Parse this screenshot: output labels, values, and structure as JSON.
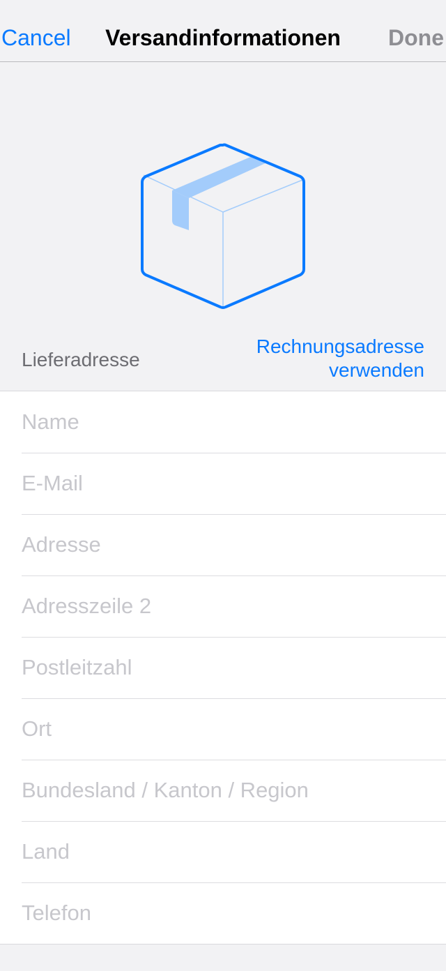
{
  "navbar": {
    "cancel_label": "Cancel",
    "title": "Versandinformationen",
    "done_label": "Done"
  },
  "colors": {
    "accent": "#0a7aff",
    "disabled": "#8e8e93",
    "placeholder": "#c7c7cc",
    "background": "#f2f2f4",
    "box_light": "#a3ccfb"
  },
  "hero": {
    "icon": "package-box-icon"
  },
  "section": {
    "label": "Lieferadresse",
    "billing_link_line1": "Rechnungsadresse",
    "billing_link_line2": "verwenden"
  },
  "fields": [
    {
      "name": "name-field",
      "placeholder": "Name",
      "value": ""
    },
    {
      "name": "email-field",
      "placeholder": "E-Mail",
      "value": ""
    },
    {
      "name": "address-field",
      "placeholder": "Adresse",
      "value": ""
    },
    {
      "name": "address-line2-field",
      "placeholder": "Adresszeile 2",
      "value": ""
    },
    {
      "name": "postal-code-field",
      "placeholder": "Postleitzahl",
      "value": ""
    },
    {
      "name": "city-field",
      "placeholder": "Ort",
      "value": ""
    },
    {
      "name": "state-field",
      "placeholder": "Bundesland / Kanton / Region",
      "value": ""
    },
    {
      "name": "country-field",
      "placeholder": "Land",
      "value": ""
    },
    {
      "name": "phone-field",
      "placeholder": "Telefon",
      "value": ""
    }
  ]
}
